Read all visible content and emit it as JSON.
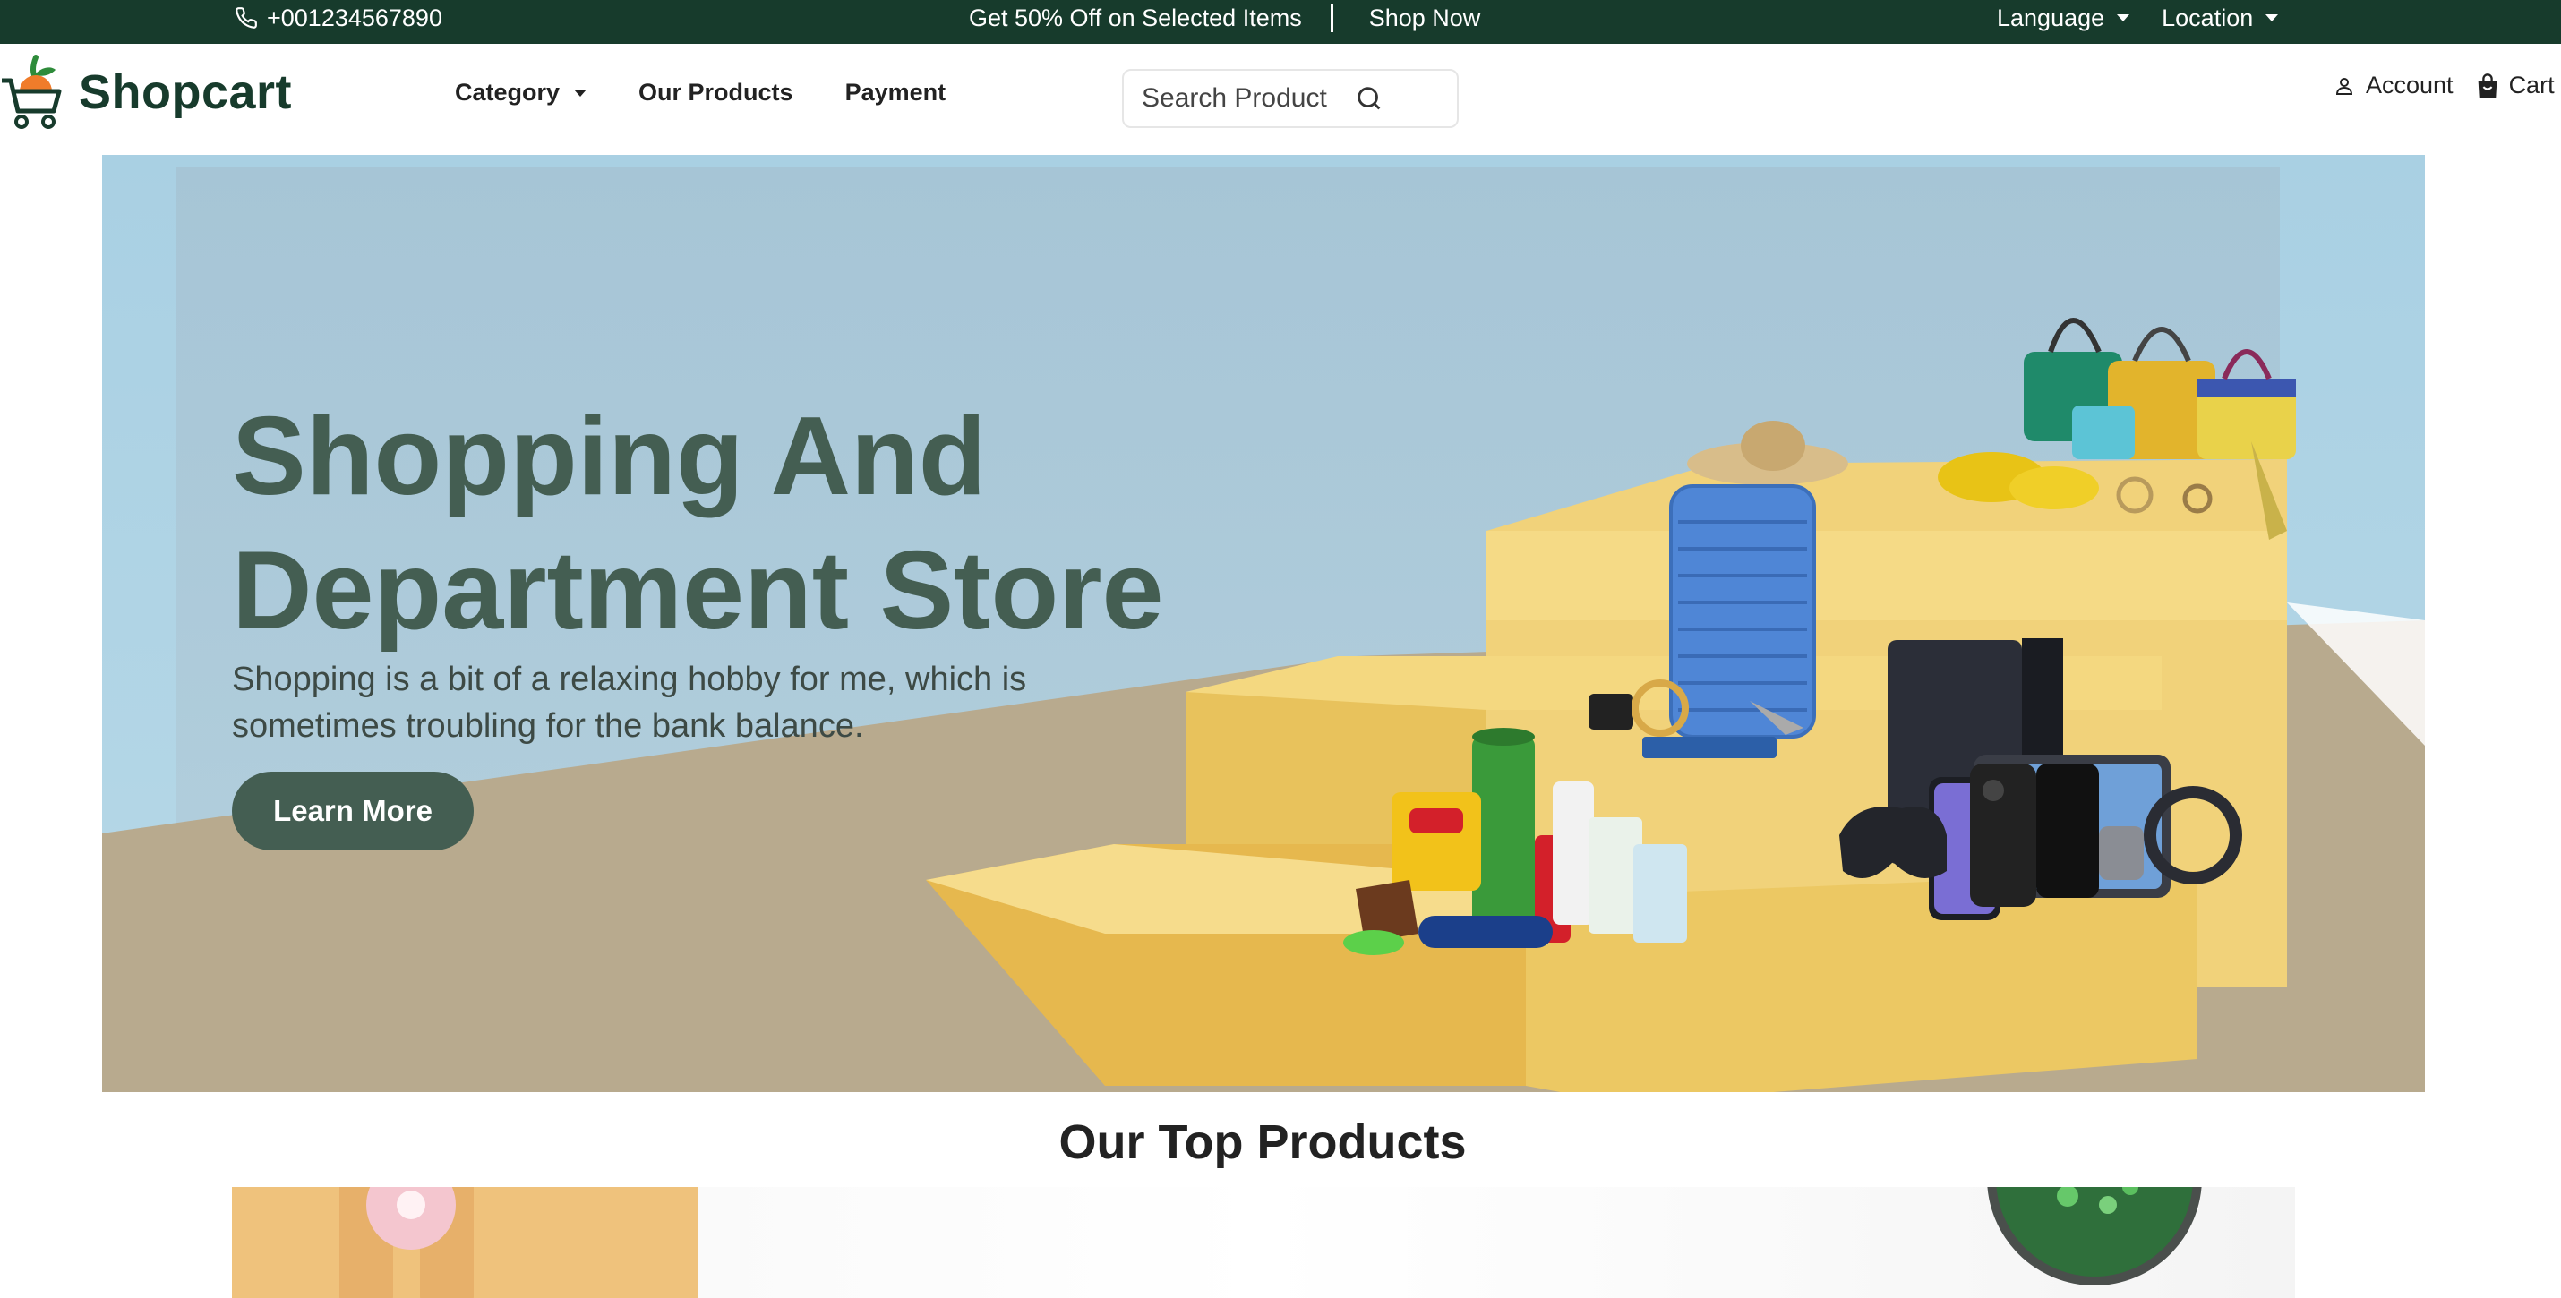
{
  "topbar": {
    "phone": "+001234567890",
    "promo_text": "Get 50% Off on Selected Items",
    "shop_now": "Shop Now",
    "language": "Language",
    "location": "Location"
  },
  "brand": {
    "name": "Shopcart"
  },
  "nav": {
    "category": "Category",
    "products": "Our Products",
    "payment": "Payment"
  },
  "search": {
    "placeholder": "Search Product"
  },
  "user": {
    "account": "Account",
    "cart": "Cart"
  },
  "hero": {
    "title": "Shopping And Department Store",
    "subtitle": "Shopping is a bit of a relaxing hobby for me, which is sometimes troubling for the bank balance.",
    "cta": "Learn More"
  },
  "section": {
    "title": "Our Top Products"
  },
  "colors": {
    "brand": "#173b2c",
    "accent": "#445e52",
    "podium": "#f2cf6b"
  }
}
